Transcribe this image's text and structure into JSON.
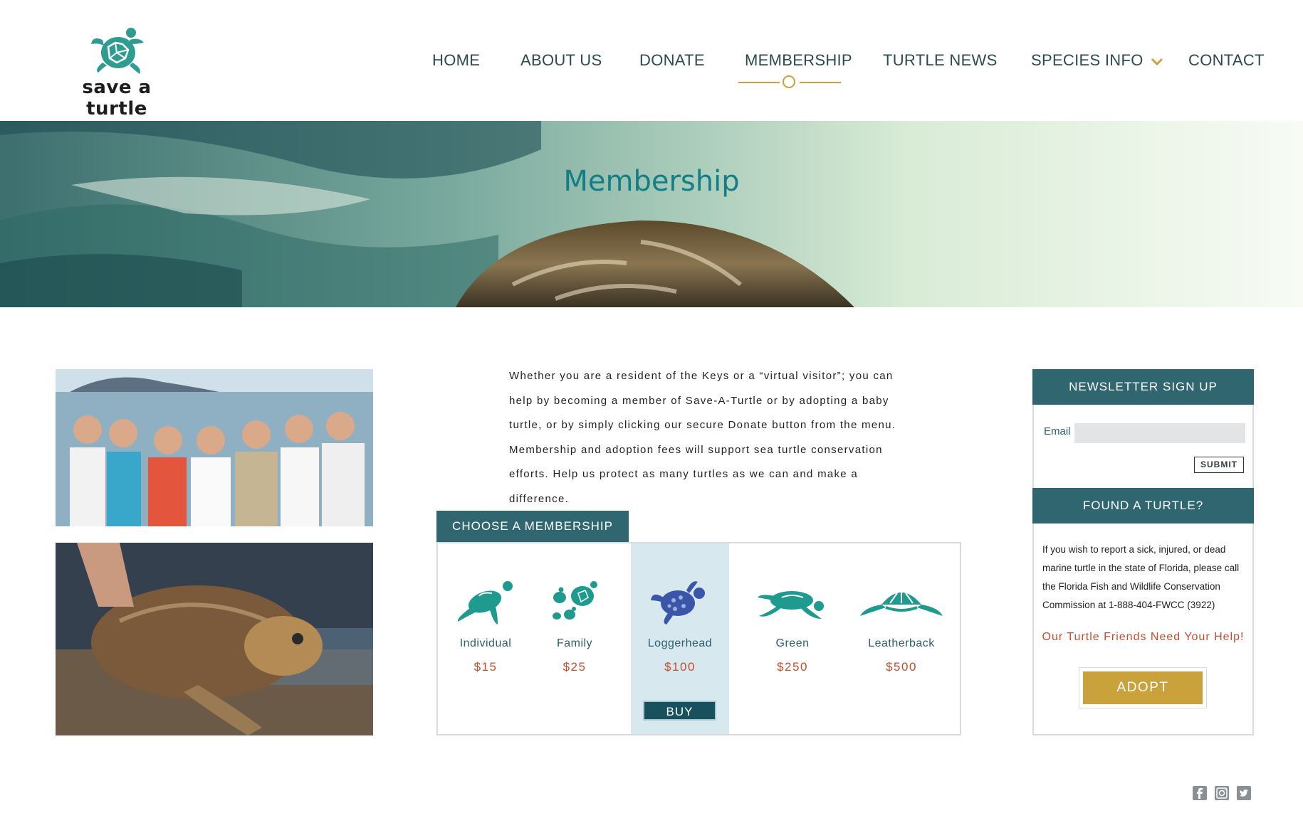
{
  "brand": {
    "logo_text": "save a turtle"
  },
  "nav": {
    "items": [
      "HOME",
      "ABOUT US",
      "DONATE",
      "MEMBERSHIP",
      "TURTLE NEWS",
      "SPECIES INFO",
      "CONTACT"
    ],
    "active": "MEMBERSHIP"
  },
  "hero": {
    "title": "Membership"
  },
  "intro": {
    "text": "Whether you are a resident of the Keys or a “virtual visitor”; you can help by becoming a member of Save-A-Turtle or by adopting a baby turtle, or by simply clicking our secure Donate button from the menu. Membership and adoption fees will support sea turtle conservation efforts. Help us protect as many turtles as we can and make a difference."
  },
  "membership": {
    "tab_label": "CHOOSE A MEMBERSHIP",
    "selected": "Loggerhead",
    "buy_label": "BUY",
    "options": [
      {
        "name": "Individual",
        "price": "$15",
        "icon": "sea-turtle-swimming-icon"
      },
      {
        "name": "Family",
        "price": "$25",
        "icon": "turtle-family-icon"
      },
      {
        "name": "Loggerhead",
        "price": "$100",
        "icon": "loggerhead-turtle-icon"
      },
      {
        "name": "Green",
        "price": "$250",
        "icon": "green-turtle-icon"
      },
      {
        "name": "Leatherback",
        "price": "$500",
        "icon": "leatherback-turtle-icon"
      }
    ]
  },
  "newsletter": {
    "heading": "NEWSLETTER SIGN UP",
    "email_label": "Email",
    "email_value": "",
    "submit_label": "SUBMIT"
  },
  "found": {
    "heading": "FOUND A TURTLE?",
    "text": "If you wish to report a sick, injured, or dead marine turtle in the state of Florida, please call the Florida Fish and Wildlife Conservation Commission at 1-888-404-FWCC (3922)",
    "help_text": "Our Turtle Friends Need Your Help!",
    "adopt_label": "ADOPT"
  },
  "social": [
    "facebook-icon",
    "instagram-icon",
    "twitter-icon"
  ],
  "colors": {
    "teal": "#2f6670",
    "accent_gold": "#c9a23c",
    "price_red": "#c44e2e",
    "title_teal": "#117f85",
    "highlight": "#d7e8ee"
  }
}
